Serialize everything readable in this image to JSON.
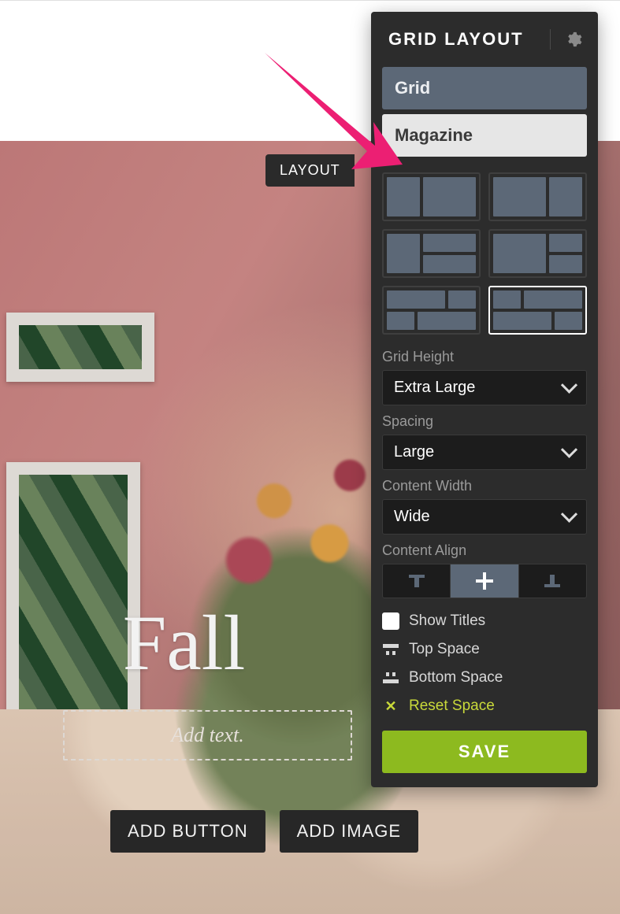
{
  "layout_tag": "LAYOUT",
  "hero": {
    "title": "Fall",
    "placeholder": "Add text.",
    "add_button": "ADD BUTTON",
    "add_image": "ADD IMAGE"
  },
  "panel": {
    "title": "GRID LAYOUT",
    "types": {
      "grid": "Grid",
      "magazine": "Magazine"
    },
    "selected_type": "magazine",
    "selected_thumb": 6,
    "grid_height": {
      "label": "Grid Height",
      "value": "Extra Large"
    },
    "spacing": {
      "label": "Spacing",
      "value": "Large"
    },
    "content_width": {
      "label": "Content Width",
      "value": "Wide"
    },
    "content_align": {
      "label": "Content Align",
      "value": "center"
    },
    "show_titles": {
      "label": "Show Titles",
      "checked": false
    },
    "top_space": "Top Space",
    "bottom_space": "Bottom Space",
    "reset_space": "Reset Space",
    "save": "SAVE"
  },
  "colors": {
    "panel_bg": "#2c2c2c",
    "accent": "#8dba1f",
    "slate": "#5c6877",
    "arrow": "#ec1f73"
  }
}
